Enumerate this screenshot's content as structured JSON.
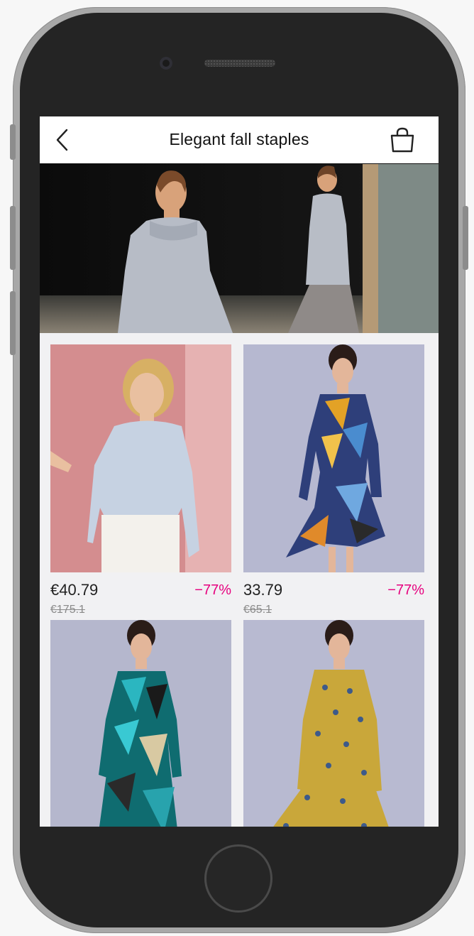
{
  "header": {
    "title": "Elegant fall staples",
    "back_icon": "chevron-left-icon",
    "cart_icon": "shopping-bag-icon"
  },
  "banner": {
    "image": "hero-fall-models"
  },
  "products": [
    {
      "image": "model-pale-blue-blouse",
      "price": "€40.79",
      "old_price": "€175.1",
      "discount": "−77%"
    },
    {
      "image": "model-geometric-print-dress",
      "price": "33.79",
      "old_price": "€65.1",
      "discount": "−77%"
    },
    {
      "image": "model-teal-print-dress",
      "price": "",
      "old_price": "",
      "discount": ""
    },
    {
      "image": "model-mustard-floral-dress",
      "price": "",
      "old_price": "",
      "discount": ""
    }
  ],
  "colors": {
    "discount": "#e6007e",
    "screen_bg": "#f1f1f3",
    "navbar_bg": "#ffffff"
  }
}
